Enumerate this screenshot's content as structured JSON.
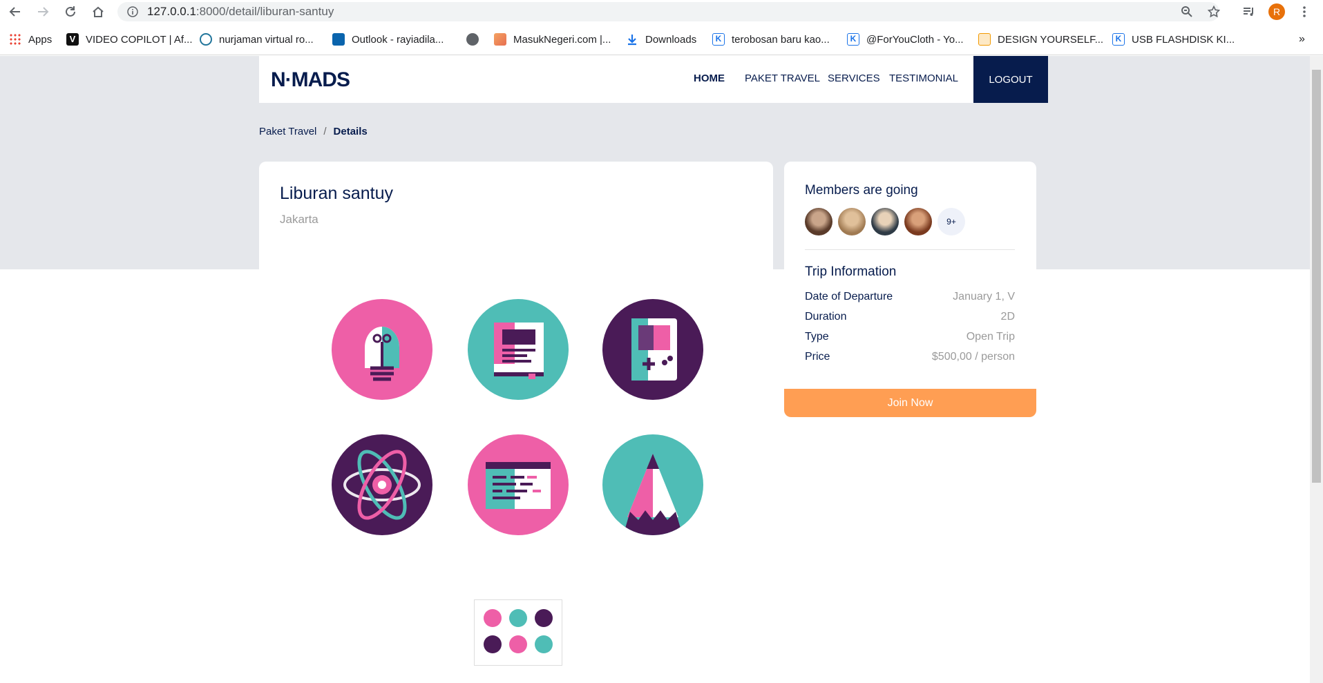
{
  "browser": {
    "url_host": "127.0.0.1",
    "url_path": ":8000/detail/liburan-santuy",
    "profile_initial": "R",
    "profile_color": "#e8710a"
  },
  "bookmarks": [
    {
      "label": "Apps",
      "icon": "apps-grid-icon"
    },
    {
      "label": "VIDEO COPILOT | Af...",
      "icon": "videocopilot-icon"
    },
    {
      "label": "nurjaman virtual ro...",
      "icon": "wordpress-icon"
    },
    {
      "label": "Outlook - rayiadila...",
      "icon": "outlook-icon"
    },
    {
      "label": "",
      "icon": "globe-icon"
    },
    {
      "label": "MasukNegeri.com |...",
      "icon": "masuknegeri-icon"
    },
    {
      "label": "Downloads",
      "icon": "download-icon"
    },
    {
      "label": "terobosan baru kao...",
      "icon": "bookmark-k-icon"
    },
    {
      "label": "@ForYouCloth - Yo...",
      "icon": "bookmark-k-icon"
    },
    {
      "label": "DESIGN YOURSELF...",
      "icon": "design-icon"
    },
    {
      "label": "USB FLASHDISK KI...",
      "icon": "bookmark-k-icon"
    }
  ],
  "bookmarks_more": "»",
  "navbar": {
    "logo": "N·MADS",
    "links": [
      "HOME",
      "PAKET TRAVEL",
      "SERVICES",
      "TESTIMONIAL"
    ],
    "logout": "LOGOUT"
  },
  "breadcrumb": {
    "parent": "Paket Travel",
    "separator": "/",
    "current": "Details"
  },
  "detail": {
    "title": "Liburan santuy",
    "location": "Jakarta"
  },
  "members": {
    "title": "Members are going",
    "more": "9+"
  },
  "trip": {
    "title": "Trip Information",
    "rows": [
      {
        "label": "Date of Departure",
        "value": "January 1, V"
      },
      {
        "label": "Duration",
        "value": "2D"
      },
      {
        "label": "Type",
        "value": "Open Trip"
      },
      {
        "label": "Price",
        "value": "$500,00 / person"
      }
    ],
    "cta": "Join Now"
  },
  "colors": {
    "navy": "#071c4d",
    "pink": "#ee5fa7",
    "teal": "#4fbdb6",
    "purple": "#4a1b57",
    "orange": "#ff9e53"
  }
}
